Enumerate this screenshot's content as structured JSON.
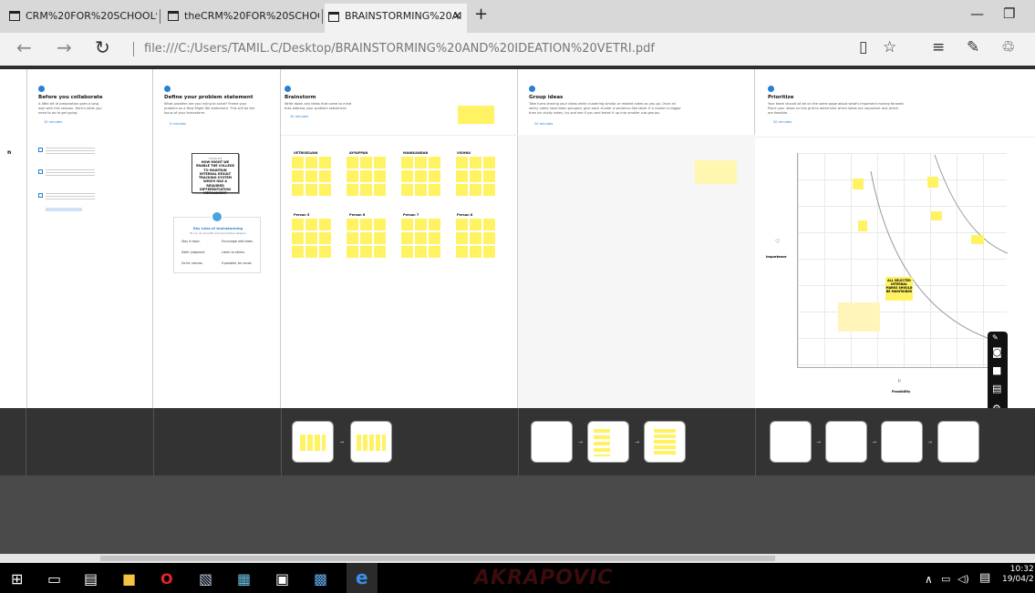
{
  "tabs": [
    {
      "label": "CRM%20FOR%20SCHOOL%"
    },
    {
      "label": "theCRM%20FOR%20SCHOO"
    },
    {
      "label": "BRAINSTORMING%20AI"
    }
  ],
  "address": {
    "url": "file:///C:/Users/TAMIL.C/Desktop/BRAINSTORMING%20AND%20IDEATION%20VETRI.pdf"
  },
  "panels": [
    {
      "title": "Before you collaborate",
      "desc": "A little bit of preparation goes a long way with this session. Here's what you need to do to get going.",
      "time": "10 minutes"
    },
    {
      "title": "Define your problem statement",
      "desc": "What problem are you trying to solve? Frame your problem as a How Might We statement. This will be the focus of your brainstorm.",
      "time": "5 minutes"
    },
    {
      "title": "Brainstorm",
      "desc": "Write down any ideas that come to mind that address your problem statement.",
      "time": "10 minutes"
    },
    {
      "title": "Group ideas",
      "desc": "Take turns sharing your ideas while clustering similar or related notes as you go. Once all sticky notes have been grouped, give each cluster a sentence-like label. If a cluster is bigger than six sticky notes, try and see if you and break it up into smaller sub-groups.",
      "time": "20 minutes"
    },
    {
      "title": "Prioritize",
      "desc": "Your team should all be on the same page about what's important moving forward. Place your ideas on this grid to determine which ideas are important and which are feasible.",
      "time": "20 minutes"
    }
  ],
  "problem": {
    "label": "PROBLEM",
    "statement": "HOW MIGHT WE ENABLE THE COLLEGE TO MAINTAIN INTERNAL RESULT TRACKING SYSTEM WHICH HAS A REQUIRED DIFFERENTIATION MECHANISM?"
  },
  "rules": {
    "title": "Key rules of brainstorming",
    "sub": "To run an smooth and productive session",
    "items": [
      "Stay in topic.",
      "Encourage wild ideas.",
      "Defer judgment.",
      "Listen to others.",
      "Go for volume.",
      "If possible, be visual."
    ]
  },
  "groups": [
    "VETRISELVAN",
    "AYYAPPAN",
    "MANIKANDAN",
    "VISHNU",
    "Person 5",
    "Person 6",
    "Person 7",
    "Person 8"
  ],
  "prioritize": {
    "yaxis": "Importance",
    "xaxis": "Feasibility",
    "highlight": "ALL SELECTED INTERNAL MARKS SHOULD BE MAINTAINED"
  },
  "clock": {
    "time": "10:32",
    "date": "19/04/2"
  },
  "brand": "AKRAPOVIC"
}
